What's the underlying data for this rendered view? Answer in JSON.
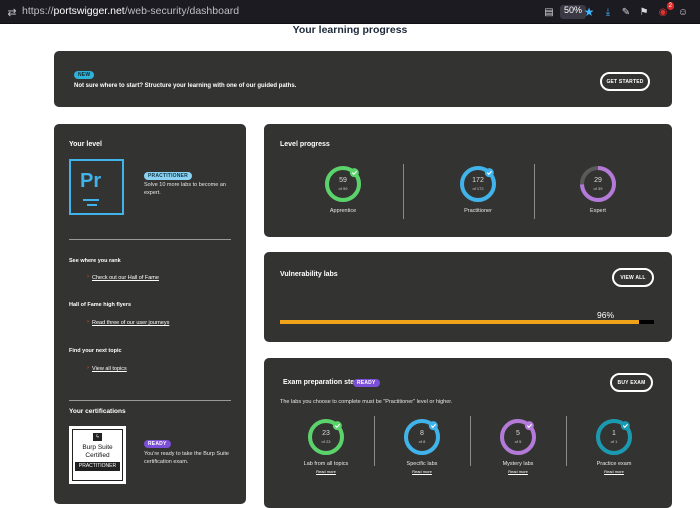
{
  "browser": {
    "url_scheme": "https://",
    "url_host": "portswigger.net",
    "url_path": "/web-security/dashboard",
    "zoom": "50%",
    "extension_badge": "2"
  },
  "page": {
    "title": "Your learning progress"
  },
  "banner": {
    "badge": "NEW",
    "text": "Not sure where to start? Structure your learning with one of our guided paths.",
    "button": "GET STARTED"
  },
  "level_card": {
    "heading": "Your level",
    "logo_text": "Pr",
    "badge": "PRACTITIONER",
    "message": "Solve 10 more labs to become an expert.",
    "rank_heading": "See where you rank",
    "rank_link": "Check out our Hall of Fame",
    "hof_heading": "Hall of Fame high flyers",
    "hof_link": "Read three of our user journeys",
    "next_heading": "Find your next topic",
    "next_link": "View all topics",
    "cert_heading": "Your certifications",
    "cert_line1": "Burp Suite",
    "cert_line2": "Certified",
    "cert_line3": "PRACTITIONER",
    "cert_badge": "READY",
    "cert_message": "You're ready to take the Burp Suite certification exam."
  },
  "level_progress": {
    "heading": "Level progress",
    "items": [
      {
        "num": "59",
        "sub": "of 59",
        "label": "Apprentice",
        "fraction": 1.0,
        "color": "#5bd36b",
        "done": true
      },
      {
        "num": "172",
        "sub": "of 172",
        "label": "Practitioner",
        "fraction": 1.0,
        "color": "#3fb3ea",
        "done": true
      },
      {
        "num": "29",
        "sub": "of 39",
        "label": "Expert",
        "fraction": 0.744,
        "color": "#b47ad9",
        "done": false
      }
    ]
  },
  "vuln_labs": {
    "heading": "Vulnerability labs",
    "button": "VIEW ALL",
    "percent_label": "96%",
    "percent": 0.96,
    "bar_color": "#f0a318"
  },
  "exam": {
    "heading": "Exam preparation steps",
    "badge": "READY",
    "button": "BUY EXAM",
    "note": "The labs you choose to complete must be \"Practitioner\" level or higher.",
    "items": [
      {
        "num": "23",
        "sub": "of 23",
        "label": "Lab from all topics",
        "link": "Read more",
        "fraction": 1.0,
        "color": "#5bd36b"
      },
      {
        "num": "8",
        "sub": "of 8",
        "label": "Specific labs",
        "link": "Read more",
        "fraction": 1.0,
        "color": "#3fb3ea"
      },
      {
        "num": "5",
        "sub": "of 5",
        "label": "Mystery labs",
        "link": "Read more",
        "fraction": 1.0,
        "color": "#b47ad9"
      },
      {
        "num": "1",
        "sub": "of 1",
        "label": "Practice exam",
        "link": "Read more",
        "fraction": 1.0,
        "color": "#1a9ab0"
      }
    ]
  }
}
